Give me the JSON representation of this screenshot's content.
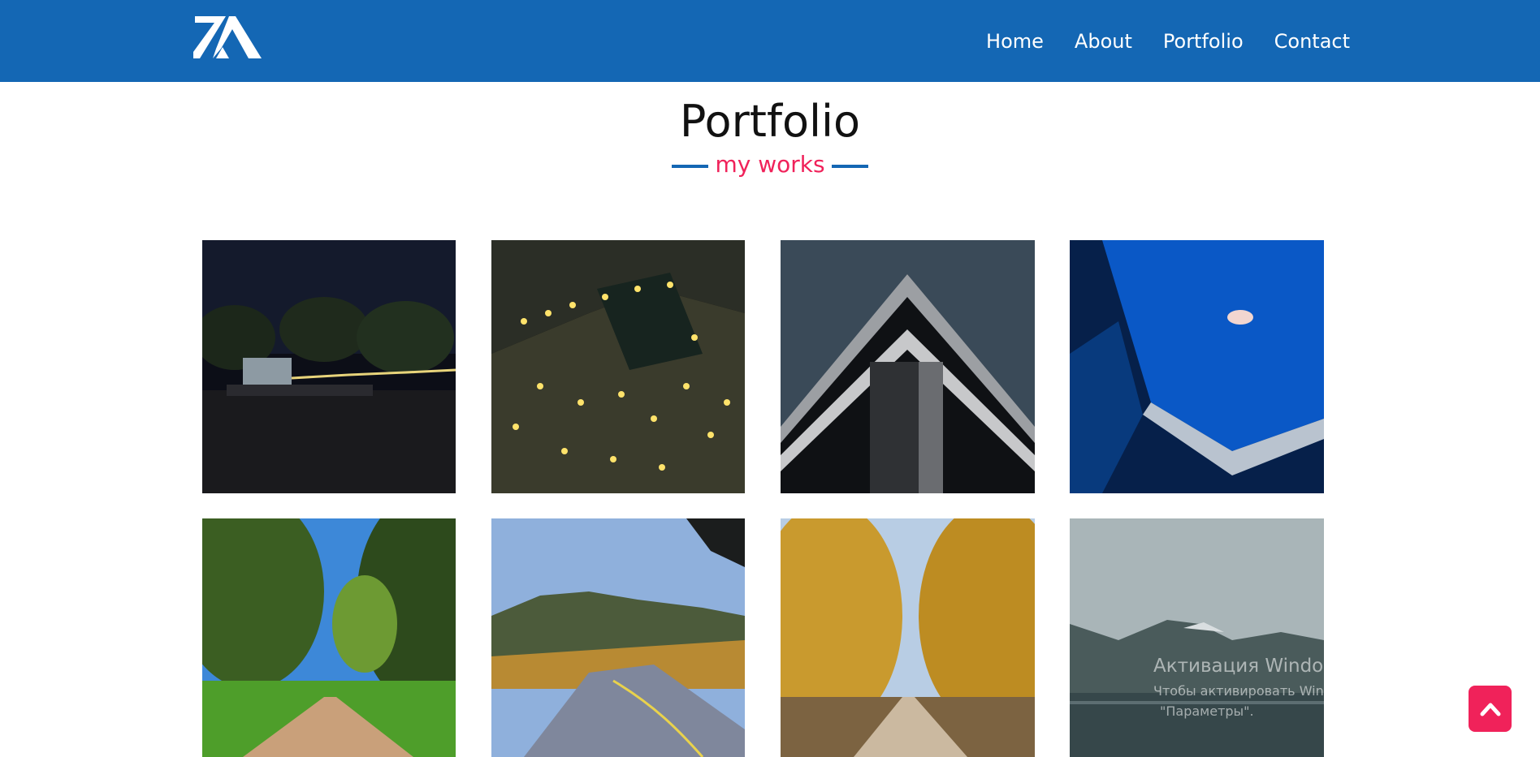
{
  "nav": {
    "logo_text": "ZA",
    "items": [
      {
        "label": "Home"
      },
      {
        "label": "About"
      },
      {
        "label": "Portfolio"
      },
      {
        "label": "Contact"
      }
    ]
  },
  "section": {
    "title": "Portfolio",
    "subtitle": "my works"
  },
  "gallery": {
    "items": [
      {
        "subject": "outdoor-cinema-night"
      },
      {
        "subject": "lights-on-bus-night"
      },
      {
        "subject": "building-corner"
      },
      {
        "subject": "blue-laptop"
      },
      {
        "subject": "tree-lined-path"
      },
      {
        "subject": "mountain-road"
      },
      {
        "subject": "autumn-birch-alley"
      },
      {
        "subject": "mountain-lake"
      }
    ]
  },
  "watermark": {
    "title": "Активация Windows",
    "line1": "Чтобы активировать Windows, перейдите в раздел",
    "line2": "\"Параметры\"."
  },
  "colors": {
    "brand": "#1467b4",
    "accent": "#f0225a"
  },
  "icons": {
    "back_to_top": "chevron-up-icon"
  }
}
